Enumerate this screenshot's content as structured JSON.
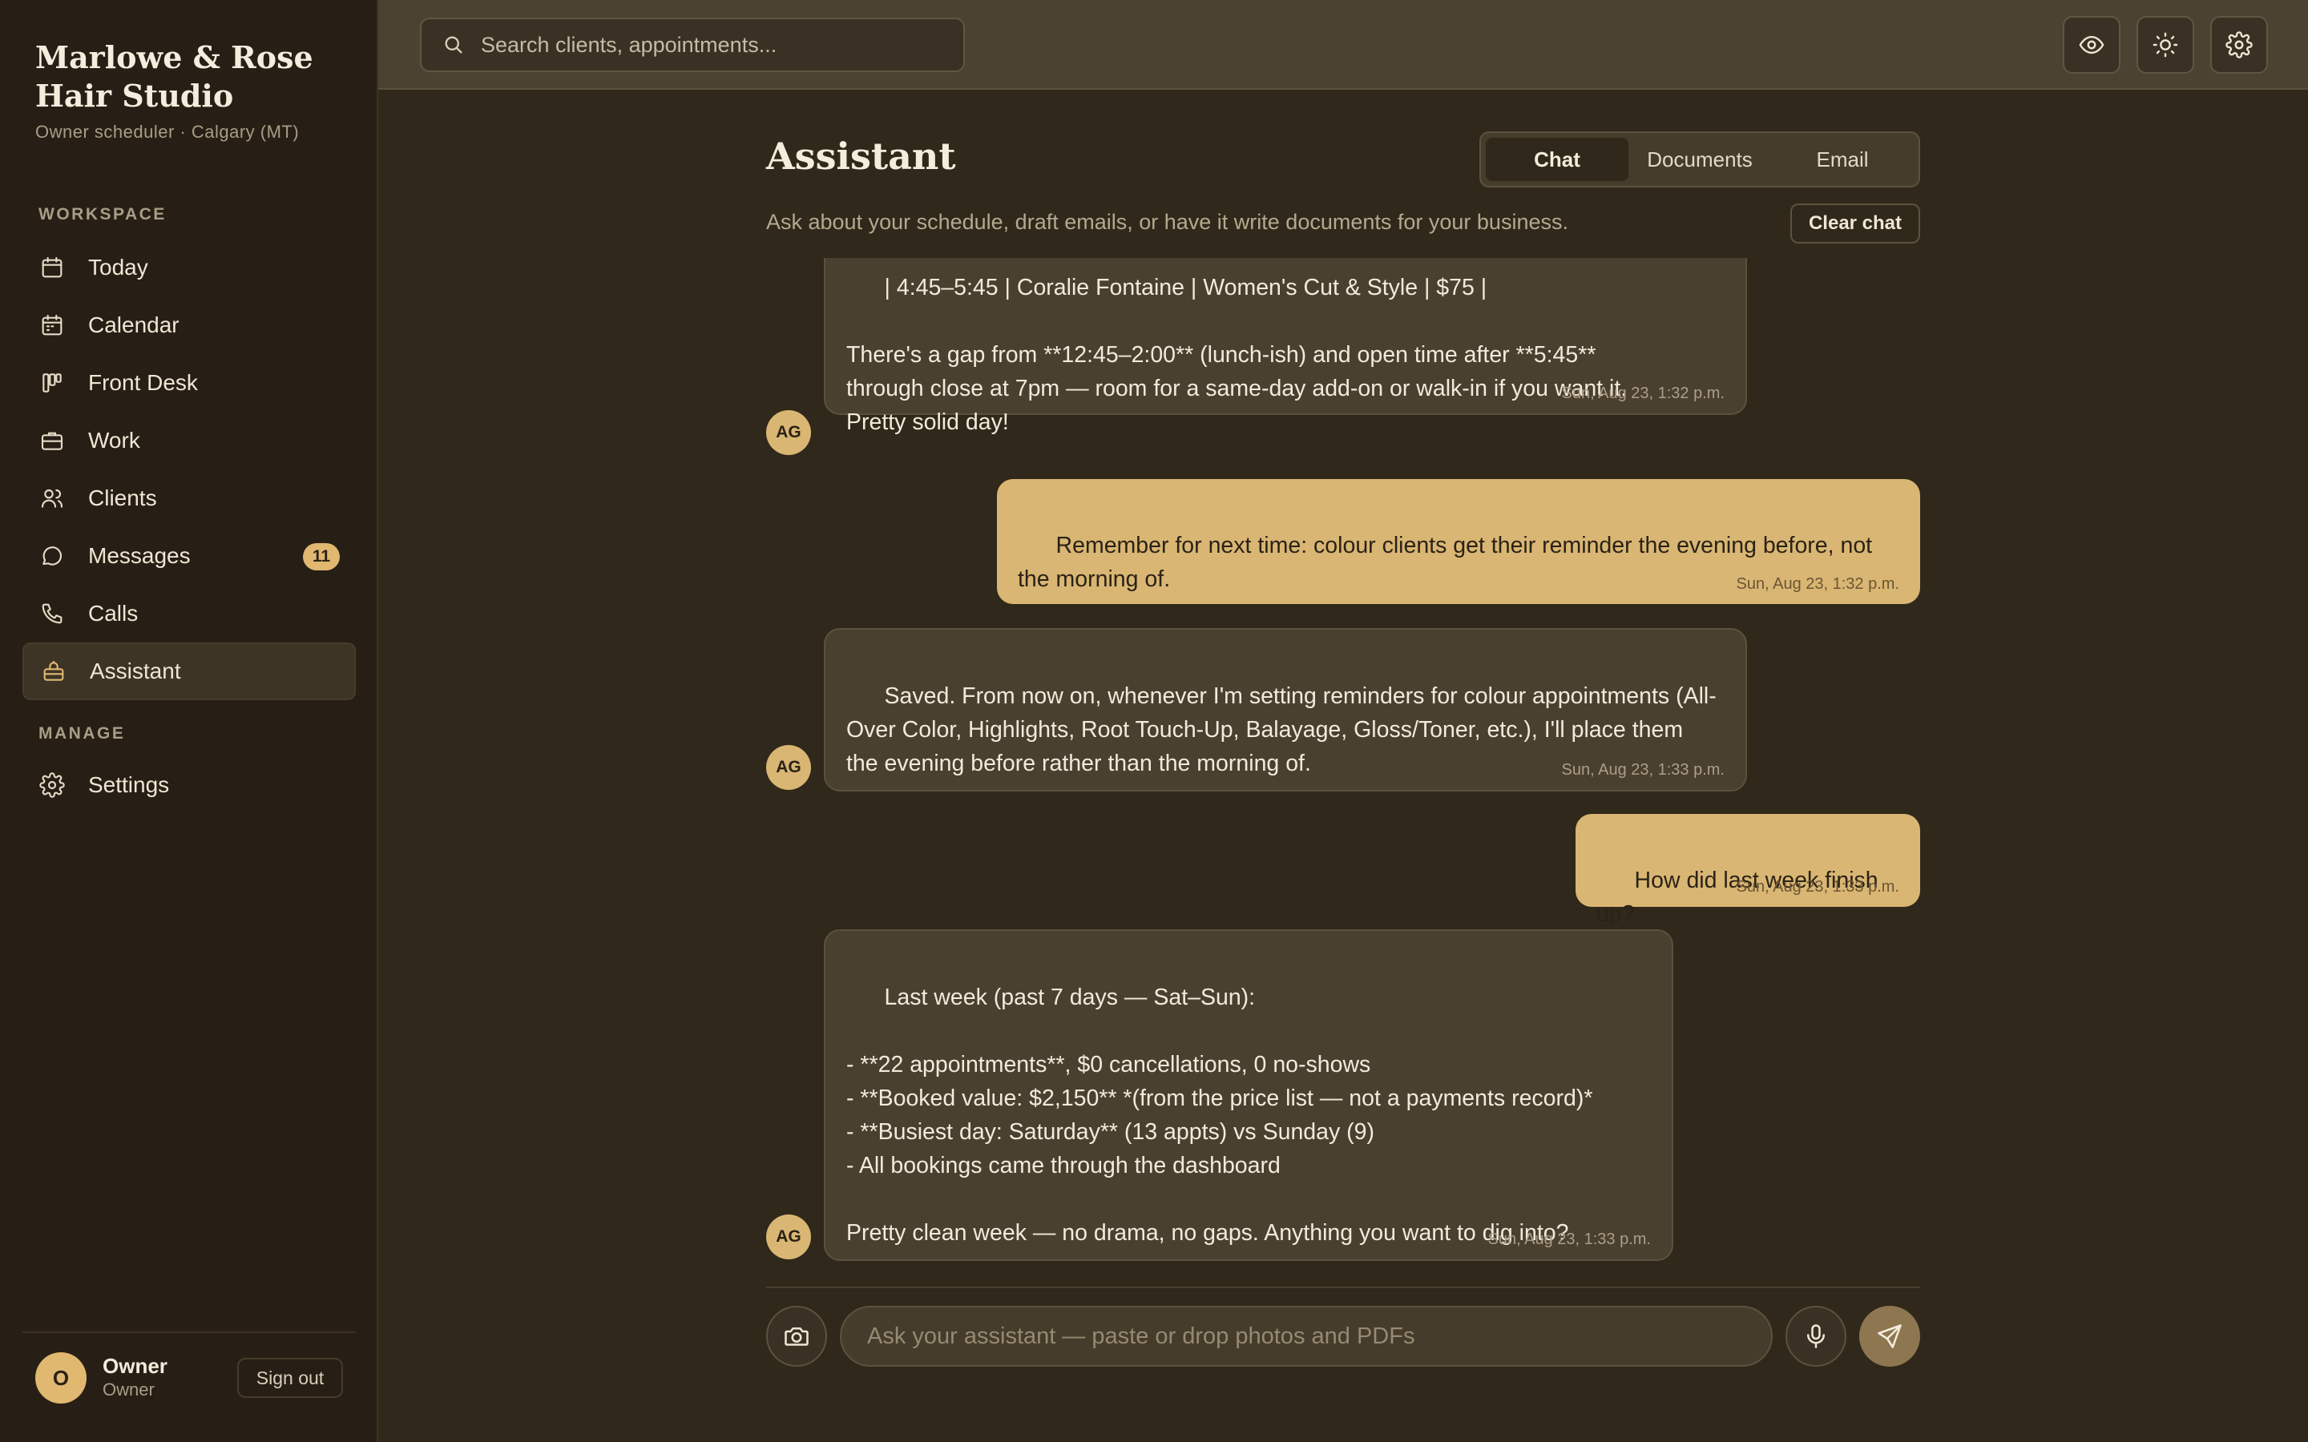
{
  "brand": {
    "name": "Marlowe & Rose Hair Studio",
    "subtitle": "Owner scheduler · Calgary (MT)"
  },
  "sidebar": {
    "workspace_label": "WORKSPACE",
    "manage_label": "MANAGE",
    "items": [
      {
        "label": "Today",
        "icon": "calendar-icon"
      },
      {
        "label": "Calendar",
        "icon": "calendar-grid-icon"
      },
      {
        "label": "Front Desk",
        "icon": "kanban-icon"
      },
      {
        "label": "Work",
        "icon": "briefcase-icon"
      },
      {
        "label": "Clients",
        "icon": "users-icon"
      },
      {
        "label": "Messages",
        "icon": "message-icon",
        "badge": "11"
      },
      {
        "label": "Calls",
        "icon": "phone-icon"
      },
      {
        "label": "Assistant",
        "icon": "bot-icon",
        "active": true
      }
    ],
    "manage_items": [
      {
        "label": "Settings",
        "icon": "gear-icon"
      }
    ],
    "user": {
      "initial": "O",
      "name": "Owner",
      "role": "Owner",
      "signout_label": "Sign out"
    }
  },
  "topbar": {
    "search_placeholder": "Search clients, appointments...",
    "icons": [
      "eye-icon",
      "sun-icon",
      "gear-icon"
    ]
  },
  "main": {
    "title": "Assistant",
    "subtitle": "Ask about your schedule, draft emails, or have it write documents for your business.",
    "tabs": [
      {
        "label": "Chat",
        "active": true
      },
      {
        "label": "Documents"
      },
      {
        "label": "Email"
      }
    ],
    "clear_label": "Clear chat",
    "messages": [
      {
        "role": "assistant",
        "avatar": "AG",
        "text": "| 4:45–5:45 | Coralie Fontaine | Women's Cut & Style | $75 |\n\nThere's a gap from **12:45–2:00** (lunch-ish) and open time after **5:45**\nthrough close at 7pm — room for a same-day add-on or walk-in if you want it.\nPretty solid day!",
        "time": "Sun, Aug 23, 1:32 p.m."
      },
      {
        "role": "user",
        "text": "Remember for next time: colour clients get their reminder the evening before, not\nthe morning of.",
        "time": "Sun, Aug 23, 1:32 p.m."
      },
      {
        "role": "assistant",
        "avatar": "AG",
        "text": "Saved. From now on, whenever I'm setting reminders for colour appointments (All-\nOver Color, Highlights, Root Touch-Up, Balayage, Gloss/Toner, etc.), I'll place them\nthe evening before rather than the morning of.",
        "time": "Sun, Aug 23, 1:33 p.m."
      },
      {
        "role": "user",
        "text": "How did last week finish up?",
        "time": "Sun, Aug 23, 1:33 p.m."
      },
      {
        "role": "assistant",
        "avatar": "AG",
        "text": "Last week (past 7 days — Sat–Sun):\n\n- **22 appointments**, $0 cancellations, 0 no-shows\n- **Booked value: $2,150** *(from the price list — not a payments record)*\n- **Busiest day: Saturday** (13 appts) vs Sunday (9)\n- All bookings came through the dashboard\n\nPretty clean week — no drama, no gaps. Anything you want to dig into?",
        "time": "Sun, Aug 23, 1:33 p.m."
      }
    ],
    "composer": {
      "placeholder": "Ask your assistant — paste or drop photos and PDFs"
    }
  },
  "colors": {
    "accent": "#d9b673",
    "background": "#30281a",
    "sidebar": "#271f15",
    "topbar": "#4c4231"
  }
}
